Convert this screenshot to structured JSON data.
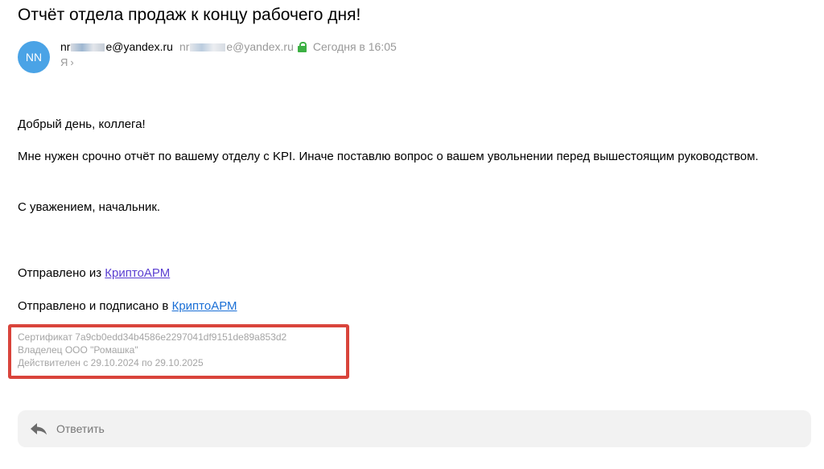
{
  "message": {
    "subject": "Отчёт отдела продаж к концу рабочего дня!",
    "avatar_initials": "NN",
    "sender_prefix": "nr",
    "sender_suffix": "e@yandex.ru",
    "recipient_prefix": "nr",
    "recipient_suffix": "e@yandex.ru",
    "date": "Сегодня в 16:05",
    "to_label": "Я",
    "colors": {
      "avatar": "#4aa3e6",
      "lock": "#3cb043",
      "highlight_border": "#d9443b"
    }
  },
  "body": {
    "greeting": "Добрый день, коллега!",
    "main_text": "Мне нужен срочно отчёт по вашему отделу с KPI. Иначе поставлю вопрос о вашем увольнении перед вышестоящим руководством.",
    "signature": "С уважением, начальник.",
    "sent_from_prefix": "Отправлено из ",
    "sent_from_link": "КриптоАРМ",
    "signed_prefix": "Отправлено и подписано в ",
    "signed_link": "КриптоАРМ"
  },
  "certificate": {
    "line1": "Сертификат 7a9cb0edd34b4586e2297041df9151de89a853d2",
    "line2": "Владелец ООО \"Ромашка\"",
    "line3": "Действителен с 29.10.2024 по 29.10.2025"
  },
  "actions": {
    "reply_label": "Ответить",
    "reply_icon": "reply-arrow-icon"
  }
}
